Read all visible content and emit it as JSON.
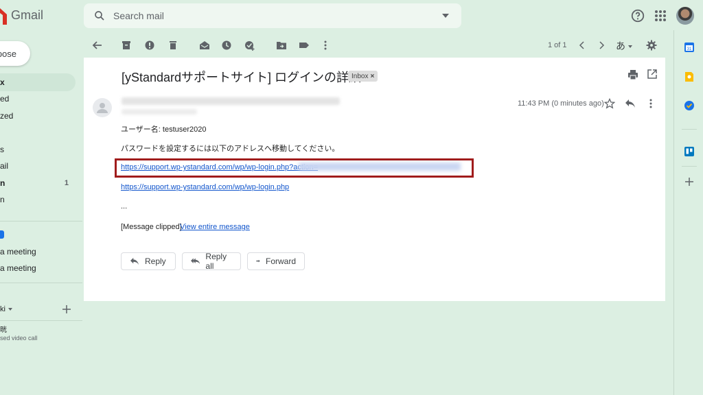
{
  "app": {
    "logo_text": "Gmail"
  },
  "search": {
    "placeholder": "Search mail"
  },
  "sidebar": {
    "compose_label": "pose",
    "items": [
      {
        "label": "x",
        "count": ""
      },
      {
        "label": "ed",
        "count": ""
      },
      {
        "label": "zed",
        "count": ""
      },
      {
        "label": "s",
        "count": ""
      },
      {
        "label": "ail",
        "count": ""
      },
      {
        "label": "n",
        "count": "1"
      },
      {
        "label": "n",
        "count": ""
      },
      {
        "label": "",
        "count": ""
      }
    ],
    "meet": [
      {
        "label": "a meeting"
      },
      {
        "label": "a meeting"
      }
    ],
    "hangouts": {
      "user_label": "ki",
      "contact_name": "晄",
      "contact_status": "sed video call"
    }
  },
  "toolbar": {
    "page_count": "1 of 1",
    "ime_label": "あ"
  },
  "message": {
    "subject": "[yStandardサポートサイト] ログインの詳細",
    "label_chip": "Inbox",
    "timestamp": "11:43 PM (0 minutes ago)",
    "body": {
      "username_line": "ユーザー名: testuser2020",
      "instruction_line": "パスワードを設定するには以下のアドレスへ移動してください。",
      "reset_link": "https://support.wp-ystandard.com/wp/wp-login.php?action=",
      "login_link": "https://support.wp-ystandard.com/wp/wp-login.php",
      "ellipsis": "...",
      "clipped_label": "[Message clipped]",
      "view_entire_label": "View entire message"
    },
    "actions": {
      "reply": "Reply",
      "reply_all": "Reply all",
      "forward": "Forward"
    }
  },
  "colors": {
    "background": "#dcefe2",
    "card": "#ffffff",
    "link": "#1155cc",
    "highlight_border": "#a01c1c",
    "gmail_red": "#d93025"
  }
}
